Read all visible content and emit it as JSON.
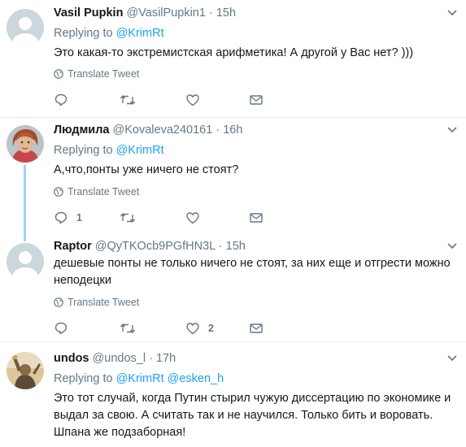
{
  "tweets": [
    {
      "name": "Vasil Pupkin",
      "handle": "@VasilPupkin1",
      "dot": "·",
      "time": "15h",
      "replying_prefix": "Replying to",
      "replying_to": "@KrimRt",
      "replying_to_2": "",
      "text": "Это какая-то экстремистская арифметика! А другой у Вас нет? )))",
      "translate": "Translate Tweet",
      "reply_count": "",
      "like_count": ""
    },
    {
      "name": "Людмила",
      "handle": "@Kovaleva240161",
      "dot": "·",
      "time": "16h",
      "replying_prefix": "Replying to",
      "replying_to": "@KrimRt",
      "replying_to_2": "",
      "text": "А,что,понты уже ничего не стоят?",
      "translate": "Translate Tweet",
      "reply_count": "1",
      "like_count": ""
    },
    {
      "name": "Raptor",
      "handle": "@QyTKOcb9PGfHN3L",
      "dot": "·",
      "time": "15h",
      "replying_prefix": "",
      "replying_to": "",
      "replying_to_2": "",
      "text": "дешевые понты не только ничего не стоят, за них еще и отгрести можно неподецки",
      "translate": "Translate Tweet",
      "reply_count": "",
      "like_count": "2"
    },
    {
      "name": "undos",
      "handle": "@undos_l",
      "dot": "·",
      "time": "17h",
      "replying_prefix": "Replying to",
      "replying_to": "@KrimRt",
      "replying_to_2": "@esken_h",
      "text": "Это тот случай, когда Путин стырил чужую диссертацию по экономике и выдал за свою. А считать так и не научился. Только бить и воровать. Шпана же подзаборная!",
      "translate": "",
      "reply_count": "",
      "like_count": ""
    }
  ],
  "colors": {
    "accent": "#1da1f2",
    "muted": "#657786",
    "separator": "#e6ecf0",
    "thread_line": "#9fd2f4"
  },
  "icons": [
    "chevron-down-icon",
    "globe-icon",
    "reply-icon",
    "retweet-icon",
    "like-icon",
    "message-icon",
    "default-avatar-icon"
  ]
}
